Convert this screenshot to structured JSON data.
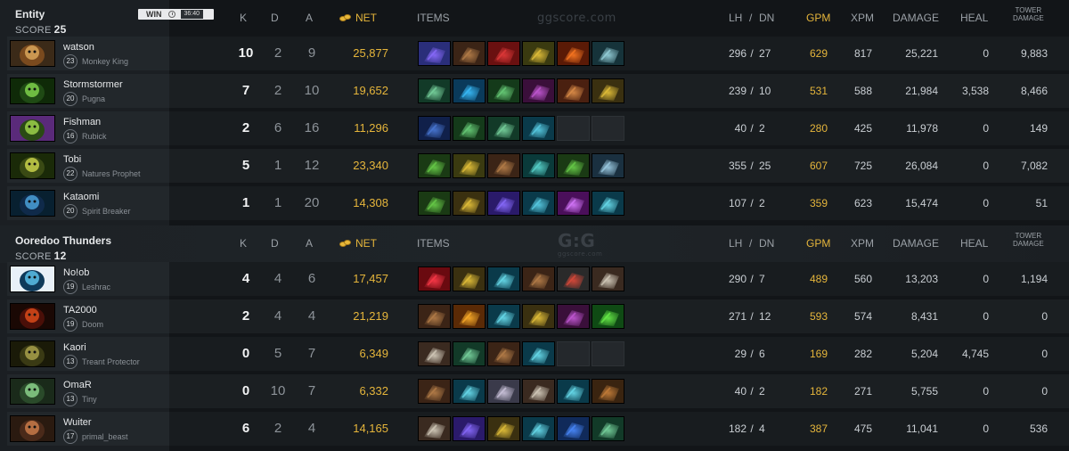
{
  "columns": {
    "k": "K",
    "d": "D",
    "a": "A",
    "net": "NET",
    "items": "ITEMS",
    "lh": "LH",
    "sep": "/",
    "dn": "DN",
    "gpm": "GPM",
    "xpm": "XPM",
    "damage": "DAMAGE",
    "heal": "HEAL",
    "tower1": "TOWER",
    "tower2": "DAMAGE"
  },
  "watermarks": {
    "top": "ggscore.com",
    "logo": "G:G",
    "logo_sub": "ggscore.com"
  },
  "colors": {
    "gold": "#e5b53b",
    "background": "#14171a",
    "panel": "#1b1f23"
  },
  "match": {
    "result": "WIN",
    "duration": "36:40"
  },
  "teams": [
    {
      "name": "Entity",
      "score_label": "SCORE",
      "score": "25",
      "players": [
        {
          "name": "watson",
          "level": "23",
          "hero": "Monkey King",
          "k": "10",
          "d": "2",
          "a": "9",
          "net": "25,877",
          "lh": "296",
          "dn": "27",
          "gpm": "629",
          "xpm": "817",
          "damage": "25,221",
          "heal": "0",
          "tower": "9,883",
          "portrait": [
            "#7a4a1e",
            "#d8a45a",
            "#3b2a18"
          ],
          "items": [
            [
              "#2a2e7a",
              "#8c6cff"
            ],
            [
              "#3b2416",
              "#b8804a"
            ],
            [
              "#6a1010",
              "#e33a3a"
            ],
            [
              "#3a3a10",
              "#e8c43a"
            ],
            [
              "#5a1a06",
              "#ff7a22"
            ],
            [
              "#16333a",
              "#9ad6e0"
            ]
          ]
        },
        {
          "name": "Stormstormer",
          "level": "20",
          "hero": "Pugna",
          "k": "7",
          "d": "2",
          "a": "10",
          "net": "19,652",
          "lh": "239",
          "dn": "10",
          "gpm": "531",
          "xpm": "588",
          "damage": "21,984",
          "heal": "3,538",
          "tower": "8,466",
          "portrait": [
            "#1f4a14",
            "#7ed04a",
            "#0f2a08"
          ],
          "items": [
            [
              "#123a28",
              "#7ad6a0"
            ],
            [
              "#0a3a5a",
              "#3ac0ff"
            ],
            [
              "#143a1a",
              "#6ad07a"
            ],
            [
              "#3a0f3a",
              "#c65ad8"
            ],
            [
              "#4a2010",
              "#e0904a"
            ],
            [
              "#3a3010",
              "#e8c43a"
            ]
          ]
        },
        {
          "name": "Fishman",
          "level": "16",
          "hero": "Rubick",
          "k": "2",
          "d": "6",
          "a": "16",
          "net": "11,296",
          "lh": "40",
          "dn": "2",
          "gpm": "280",
          "xpm": "425",
          "damage": "11,978",
          "heal": "0",
          "tower": "149",
          "portrait": [
            "#2a4a14",
            "#9cd04a",
            "#5a2a7a"
          ],
          "items": [
            [
              "#10204a",
              "#4a7ad8"
            ],
            [
              "#143a1a",
              "#6ad07a"
            ],
            [
              "#123a28",
              "#7ad6a0"
            ],
            [
              "#0a3a4a",
              "#5ad0e8"
            ],
            null,
            null
          ]
        },
        {
          "name": "Tobi",
          "level": "22",
          "hero": "Natures Prophet",
          "k": "5",
          "d": "1",
          "a": "12",
          "net": "23,340",
          "lh": "355",
          "dn": "25",
          "gpm": "607",
          "xpm": "725",
          "damage": "26,084",
          "heal": "0",
          "tower": "7,082",
          "portrait": [
            "#3a4a14",
            "#c8d04a",
            "#1a2a08"
          ],
          "items": [
            [
              "#1a3a14",
              "#6ad04a"
            ],
            [
              "#3a3a10",
              "#e8c43a"
            ],
            [
              "#3b2416",
              "#b8804a"
            ],
            [
              "#0a3a3a",
              "#5ad8d0"
            ],
            [
              "#1a3a14",
              "#6ad04a"
            ],
            [
              "#1a3040",
              "#a0d0e8"
            ]
          ]
        },
        {
          "name": "Kataomi",
          "level": "20",
          "hero": "Spirit Breaker",
          "k": "1",
          "d": "1",
          "a": "20",
          "net": "14,308",
          "lh": "107",
          "dn": "2",
          "gpm": "359",
          "xpm": "623",
          "damage": "15,474",
          "heal": "0",
          "tower": "51",
          "portrait": [
            "#0f2a4a",
            "#4aa0d8",
            "#082030"
          ],
          "items": [
            [
              "#1a3a14",
              "#6ad04a"
            ],
            [
              "#3a3010",
              "#e8c43a"
            ],
            [
              "#2a1a6a",
              "#8a6cff"
            ],
            [
              "#0a3a4a",
              "#5ad0e8"
            ],
            [
              "#4a0f5a",
              "#d87aff"
            ],
            [
              "#0a3a4a",
              "#6ae0f0"
            ]
          ]
        }
      ]
    },
    {
      "name": "Ooredoo Thunders",
      "score_label": "SCORE",
      "score": "12",
      "players": [
        {
          "name": "No!ob",
          "level": "19",
          "hero": "Leshrac",
          "k": "4",
          "d": "4",
          "a": "6",
          "net": "17,457",
          "lh": "290",
          "dn": "7",
          "gpm": "489",
          "xpm": "560",
          "damage": "13,203",
          "heal": "0",
          "tower": "1,194",
          "portrait": [
            "#0f3a5a",
            "#5ac0e8",
            "#e8f0f8"
          ],
          "items": [
            [
              "#6a0a10",
              "#ff3a4a"
            ],
            [
              "#3a3010",
              "#e8c43a"
            ],
            [
              "#0a3a4a",
              "#6ae0f0"
            ],
            [
              "#3b2416",
              "#b8804a"
            ],
            [
              "#2a2a2a",
              "#e04a3a"
            ],
            [
              "#3a2a20",
              "#d8d0c0"
            ]
          ]
        },
        {
          "name": "TA2000",
          "level": "19",
          "hero": "Doom",
          "k": "2",
          "d": "4",
          "a": "4",
          "net": "21,219",
          "lh": "271",
          "dn": "12",
          "gpm": "593",
          "xpm": "574",
          "damage": "8,431",
          "heal": "0",
          "tower": "0",
          "portrait": [
            "#4a0f08",
            "#d84a1a",
            "#1a0804"
          ],
          "items": [
            [
              "#3b2416",
              "#b8804a"
            ],
            [
              "#5a2a06",
              "#ffb02a"
            ],
            [
              "#0a3a4a",
              "#6ae0f0"
            ],
            [
              "#3a3010",
              "#e8c43a"
            ],
            [
              "#3a0f3a",
              "#c65ad8"
            ],
            [
              "#0f4a14",
              "#6af04a"
            ]
          ]
        },
        {
          "name": "Kaori",
          "level": "13",
          "hero": "Treant Protector",
          "k": "0",
          "d": "5",
          "a": "7",
          "net": "6,349",
          "lh": "29",
          "dn": "6",
          "gpm": "169",
          "xpm": "282",
          "damage": "5,204",
          "heal": "4,745",
          "tower": "0",
          "portrait": [
            "#3a3a14",
            "#a8a04a",
            "#1a1a08"
          ],
          "items": [
            [
              "#3a2a20",
              "#d8d0c0"
            ],
            [
              "#123a28",
              "#7ad6a0"
            ],
            [
              "#3b2416",
              "#b8804a"
            ],
            [
              "#0a3a4a",
              "#6ae0f0"
            ],
            null,
            null
          ]
        },
        {
          "name": "OmaR",
          "level": "13",
          "hero": "Tiny",
          "k": "0",
          "d": "10",
          "a": "7",
          "net": "6,332",
          "lh": "40",
          "dn": "2",
          "gpm": "182",
          "xpm": "271",
          "damage": "5,755",
          "heal": "0",
          "tower": "0",
          "portrait": [
            "#2a4a2a",
            "#8ad08a",
            "#1a2a1a"
          ],
          "items": [
            [
              "#3b2416",
              "#b8804a"
            ],
            [
              "#0a3a4a",
              "#6ae0f0"
            ],
            [
              "#3a3a4a",
              "#d0c8e0"
            ],
            [
              "#3a2a20",
              "#d8d0c0"
            ],
            [
              "#0a3a4a",
              "#6ae0f0"
            ],
            [
              "#3a2410",
              "#c8803a"
            ]
          ]
        },
        {
          "name": "Wuiter",
          "level": "17",
          "hero": "primal_beast",
          "k": "6",
          "d": "2",
          "a": "4",
          "net": "14,165",
          "lh": "182",
          "dn": "4",
          "gpm": "387",
          "xpm": "475",
          "damage": "11,041",
          "heal": "0",
          "tower": "536",
          "portrait": [
            "#4a2a1a",
            "#c87a4a",
            "#2a1a10"
          ],
          "items": [
            [
              "#3a2a20",
              "#d8d0c0"
            ],
            [
              "#2a1a6a",
              "#8a6cff"
            ],
            [
              "#3a3010",
              "#e8c43a"
            ],
            [
              "#0a3a4a",
              "#6ae0f0"
            ],
            [
              "#102a5a",
              "#4a8aff"
            ],
            [
              "#123a28",
              "#7ad6a0"
            ]
          ]
        }
      ]
    }
  ]
}
